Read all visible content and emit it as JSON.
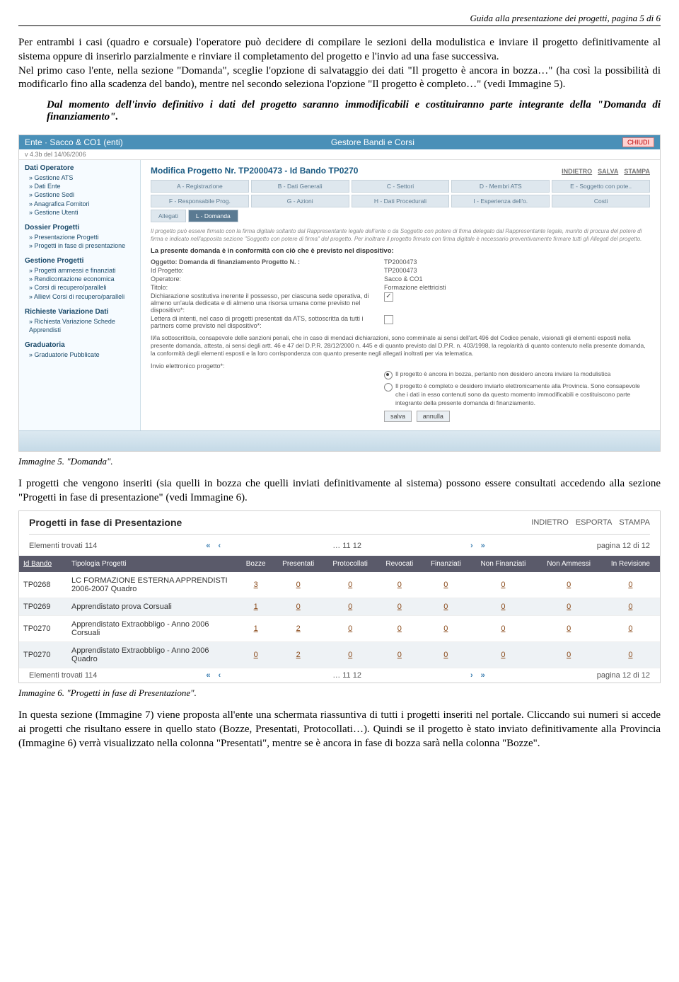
{
  "header": {
    "text": "Guida alla presentazione dei progetti, pagina 5 di 6",
    "di": "di"
  },
  "p1": "Per entrambi i casi (quadro e corsuale) l'operatore può decidere di compilare le sezioni della modulistica e inviare il progetto definitivamente al sistema oppure di inserirlo parzialmente e rinviare il completamento del progetto e l'invio ad una fase successiva.",
  "p2": "Nel primo caso l'ente, nella sezione \"Domanda\", sceglie l'opzione di salvataggio dei dati \"Il progetto è ancora in bozza…\" (ha così la possibilità di modificarlo fino alla scadenza del bando), mentre nel secondo seleziona l'opzione \"Il progetto è completo…\" (vedi Immagine 5).",
  "emph": "Dal momento dell'invio definitivo i dati del progetto saranno immodificabili e costituiranno parte integrante della \"Domanda di finanziamento\".",
  "ss1": {
    "topbar_left": "Ente · Sacco & CO1 (enti)",
    "topbar_center": "Gestore Bandi e Corsi",
    "chiudi": "CHIUDI",
    "sub": "v 4.3b del 14/06/2006",
    "sidebar": [
      {
        "title": "Dati Operatore",
        "items": [
          "Gestione ATS",
          "Dati Ente",
          "Gestione Sedi",
          "Anagrafica Fornitori",
          "Gestione Utenti"
        ]
      },
      {
        "title": "Dossier Progetti",
        "items": [
          "Presentazione Progetti",
          "Progetti in fase di presentazione"
        ]
      },
      {
        "title": "Gestione Progetti",
        "items": [
          "Progetti ammessi e finanziati",
          "Rendicontazione economica",
          "Corsi di recupero/paralleli",
          "Allievi Corsi di recupero/paralleli"
        ]
      },
      {
        "title": "Richieste Variazione Dati",
        "items": [
          "Richiesta Variazione Schede Apprendisti"
        ]
      },
      {
        "title": "Graduatoria",
        "items": [
          "Graduatorie Pubblicate"
        ]
      }
    ],
    "main_title": "Modifica Progetto Nr. TP2000473 - Id Bando TP0270",
    "right_links": [
      "INDIETRO",
      "SALVA",
      "STAMPA"
    ],
    "tabs1": [
      "A - Registrazione",
      "B - Dati Generali",
      "C - Settori",
      "D - Membri ATS",
      "E - Soggetto con pote.."
    ],
    "tabs2": [
      "F - Responsabile Prog.",
      "G - Azioni",
      "H - Dati Procedurali",
      "I - Esperienza dell'o.",
      "Costi"
    ],
    "tabs3": [
      {
        "label": "Allegati",
        "active": false
      },
      {
        "label": "L - Domanda",
        "active": true
      }
    ],
    "note": "Il progetto può essere firmato con la firma digitale soltanto dal Rappresentante legale dell'ente o da Soggetto con potere di firma delegato dal Rappresentante legale, munito di procura del potere di firma e indicato nell'apposita sezione \"Soggetto con potere di firma\" del progetto. Per inoltrare il progetto firmato con firma digitale è necessario preventivamente firmare tutti gli Allegati del progetto.",
    "bold1": "La presente domanda è in conformità con ciò che è previsto nel dispositivo:",
    "bold2": "Oggetto: Domanda di finanziamento Progetto N. :",
    "rows": [
      {
        "l": "Id Progetto:",
        "r": "TP2000473"
      },
      {
        "l": "Operatore:",
        "r": "Sacco & CO1"
      },
      {
        "l": "Titolo:",
        "r": "Formazione elettricisti"
      }
    ],
    "row_val_b2": "TP2000473",
    "check_rows": [
      "Dichiarazione sostitutiva inerente il possesso, per ciascuna sede operativa, di almeno un'aula dedicata e di almeno una risorsa umana come previsto nel dispositivo*:",
      "Lettera di intenti, nel caso di progetti presentati da ATS, sottoscritta da tutti i partners come previsto nel dispositivo*:"
    ],
    "legal": "Il/la sottoscritto/a, consapevole delle sanzioni penali, che in caso di mendaci dichiarazioni, sono comminate ai sensi dell'art.496 del Codice penale, visionati gli elementi esposti nella presente domanda, attesta, ai sensi degli artt. 46 e 47 del D.P.R. 28/12/2000 n. 445 e di quanto previsto dal D.P.R. n. 403/1998, la regolarità di quanto contenuto nella presente domanda, la conformità degli elementi esposti e la loro corrispondenza con quanto presente negli allegati inoltrati per via telematica.",
    "invio_label": "Invio elettronico progetto*:",
    "opt1": "Il progetto è ancora in bozza, pertanto non desidero ancora inviare la modulistica",
    "opt2": "Il progetto è completo e desidero inviarlo elettronicamente alla Provincia. Sono consapevole che i dati in esso contenuti sono da questo momento immodificabili e costituiscono parte integrante della presente domanda di finanziamento.",
    "btn_salva": "salva",
    "btn_annulla": "annulla"
  },
  "cap5": "Immagine 5. \"Domanda\".",
  "p3": "I progetti che vengono inseriti (sia quelli in bozza che quelli inviati definitivamente al sistema) possono essere consultati accedendo alla sezione \"Progetti in fase di presentazione\" (vedi Immagine 6).",
  "ss2": {
    "title": "Progetti in fase di Presentazione",
    "right_links": [
      "INDIETRO",
      "ESPORTA",
      "STAMPA"
    ],
    "found": "Elementi trovati 114",
    "page_center": "… 11 12",
    "page_right": "pagina 12 di 12",
    "cols": [
      "Id Bando",
      "Tipologia Progetti",
      "Bozze",
      "Presentati",
      "Protocollati",
      "Revocati",
      "Finanziati",
      "Non Finanziati",
      "Non Ammessi",
      "In Revisione"
    ],
    "rows": [
      {
        "id": "TP0268",
        "tip": "LC FORMAZIONE ESTERNA APPRENDISTI 2006-2007 Quadro",
        "v": [
          "3",
          "0",
          "0",
          "0",
          "0",
          "0",
          "0",
          "0"
        ]
      },
      {
        "id": "TP0269",
        "tip": "Apprendistato prova Corsuali",
        "v": [
          "1",
          "0",
          "0",
          "0",
          "0",
          "0",
          "0",
          "0"
        ]
      },
      {
        "id": "TP0270",
        "tip": "Apprendistato Extraobbligo - Anno 2006 Corsuali",
        "v": [
          "1",
          "2",
          "0",
          "0",
          "0",
          "0",
          "0",
          "0"
        ]
      },
      {
        "id": "TP0270",
        "tip": "Apprendistato Extraobbligo - Anno 2006 Quadro",
        "v": [
          "0",
          "2",
          "0",
          "0",
          "0",
          "0",
          "0",
          "0"
        ]
      }
    ]
  },
  "cap6": "Immagine 6. \"Progetti in fase di Presentazione\".",
  "p4": "In questa sezione (Immagine 7) viene proposta all'ente una schermata riassuntiva di tutti i progetti inseriti nel portale. Cliccando sui numeri si accede ai progetti che risultano essere in quello stato (Bozze, Presentati, Protocollati…). Quindi se il progetto è stato inviato definitivamente alla Provincia (Immagine 6) verrà visualizzato nella colonna \"Presentati\", mentre se è ancora in fase di bozza sarà nella colonna \"Bozze\"."
}
